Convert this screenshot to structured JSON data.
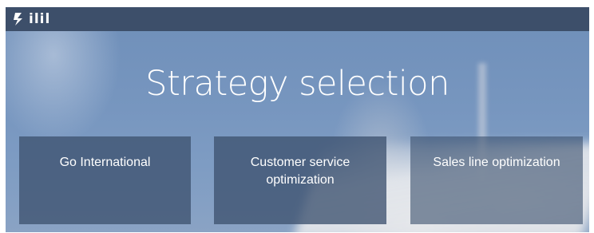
{
  "header": {
    "logo_text": "ilil",
    "logo_icon": "lightning-bolt-icon",
    "background_color": "#3d4f6a"
  },
  "main": {
    "title": "Strategy selection",
    "strategies": [
      {
        "label": "Go International"
      },
      {
        "label": "Customer service optimization"
      },
      {
        "label": "Sales line optimization"
      }
    ]
  },
  "colors": {
    "card_background": "#3e5270",
    "text": "#ffffff"
  }
}
